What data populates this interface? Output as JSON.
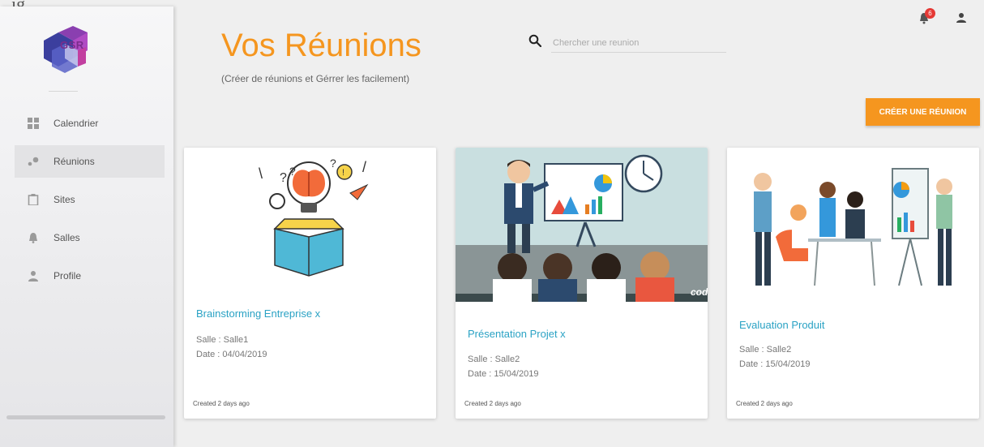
{
  "top_clip_text": "ig",
  "app": {
    "logo_text": "GSR"
  },
  "sidebar": {
    "items": [
      {
        "label": "Calendrier",
        "icon": "calendar-grid-icon",
        "active": false
      },
      {
        "label": "Réunions",
        "icon": "meeting-icon",
        "active": true
      },
      {
        "label": "Sites",
        "icon": "clipboard-icon",
        "active": false
      },
      {
        "label": "Salles",
        "icon": "bell-room-icon",
        "active": false
      },
      {
        "label": "Profile",
        "icon": "person-icon",
        "active": false
      }
    ]
  },
  "header": {
    "title": "Vos Réunions",
    "subtitle": "(Créer de réunions et Gérrer les facilement)",
    "search_placeholder": "Chercher une reunion",
    "search_value": "",
    "notification_count": "6",
    "create_button": "CRÉER UNE RÉUNION"
  },
  "cards": [
    {
      "title": "Brainstorming Entreprise x",
      "salle": "Salle : Salle1",
      "date": "Date : 04/04/2019",
      "created": "Created 2 days ago"
    },
    {
      "title": "Présentation Projet x",
      "salle": "Salle : Salle2",
      "date": "Date : 15/04/2019",
      "created": "Created 2 days ago",
      "image_caption": "cod"
    },
    {
      "title": "Evaluation Produit",
      "salle": "Salle : Salle2",
      "date": "Date : 15/04/2019",
      "created": "Created 2 days ago"
    }
  ],
  "colors": {
    "accent": "#f5961f",
    "link": "#2aa2c4",
    "brand": "#7a2d8c",
    "badge": "#e53935"
  }
}
